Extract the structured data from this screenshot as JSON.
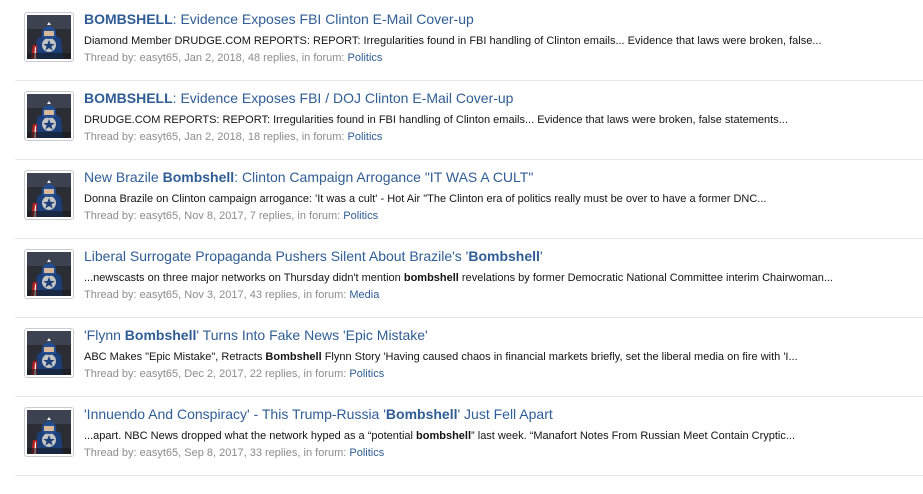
{
  "colors": {
    "link": "#2f5d95",
    "text": "#141414",
    "muted": "#8c8c8c",
    "divider": "#e3e6ea"
  },
  "avatar_icon": "captain-america-avatar",
  "results": [
    {
      "title_parts": [
        {
          "text": "BOMBSHELL",
          "bold": true
        },
        {
          "text": ": Evidence Exposes FBI Clinton E-Mail Cover-up",
          "bold": false
        }
      ],
      "snippet_parts": [
        {
          "text": "Diamond Member DRUDGE.COM REPORTS: REPORT: Irregularities found in FBI handling of Clinton emails... Evidence that laws were broken, false...",
          "bold": false
        }
      ],
      "meta_prefix": "Thread by: ",
      "author": "easyt65",
      "meta_middle": ", Jan 2, 2018, 48 replies, in forum: ",
      "forum": "Politics"
    },
    {
      "title_parts": [
        {
          "text": "BOMBSHELL",
          "bold": true
        },
        {
          "text": ": Evidence Exposes FBI / DOJ Clinton E-Mail Cover-up",
          "bold": false
        }
      ],
      "snippet_parts": [
        {
          "text": "DRUDGE.COM REPORTS: REPORT: Irregularities found in FBI handling of Clinton emails... Evidence that laws were broken, false statements...",
          "bold": false
        }
      ],
      "meta_prefix": "Thread by: ",
      "author": "easyt65",
      "meta_middle": ", Jan 2, 2018, 18 replies, in forum: ",
      "forum": "Politics"
    },
    {
      "title_parts": [
        {
          "text": "New Brazile ",
          "bold": false
        },
        {
          "text": "Bombshell",
          "bold": true
        },
        {
          "text": ": Clinton Campaign Arrogance \"IT WAS A CULT\"",
          "bold": false
        }
      ],
      "snippet_parts": [
        {
          "text": "Donna Brazile on Clinton campaign arrogance: 'It was a cult' - Hot Air \"The Clinton era of politics really must be over to have a former DNC...",
          "bold": false
        }
      ],
      "meta_prefix": "Thread by: ",
      "author": "easyt65",
      "meta_middle": ", Nov 8, 2017, 7 replies, in forum: ",
      "forum": "Politics"
    },
    {
      "title_parts": [
        {
          "text": "Liberal Surrogate Propaganda Pushers Silent About Brazile's '",
          "bold": false
        },
        {
          "text": "Bombshell",
          "bold": true
        },
        {
          "text": "'",
          "bold": false
        }
      ],
      "snippet_parts": [
        {
          "text": "...newscasts on three major networks on Thursday didn't mention ",
          "bold": false
        },
        {
          "text": "bombshell",
          "bold": true
        },
        {
          "text": " revelations by former Democratic National Committee interim Chairwoman...",
          "bold": false
        }
      ],
      "meta_prefix": "Thread by: ",
      "author": "easyt65",
      "meta_middle": ", Nov 3, 2017, 43 replies, in forum: ",
      "forum": "Media"
    },
    {
      "title_parts": [
        {
          "text": "'Flynn ",
          "bold": false
        },
        {
          "text": "Bombshell",
          "bold": true
        },
        {
          "text": "' Turns Into Fake News 'Epic Mistake'",
          "bold": false
        }
      ],
      "snippet_parts": [
        {
          "text": "ABC Makes \"Epic Mistake\", Retracts ",
          "bold": false
        },
        {
          "text": "Bombshell",
          "bold": true
        },
        {
          "text": " Flynn Story 'Having caused chaos in financial markets briefly, set the liberal media on fire with 'I...",
          "bold": false
        }
      ],
      "meta_prefix": "Thread by: ",
      "author": "easyt65",
      "meta_middle": ", Dec 2, 2017, 22 replies, in forum: ",
      "forum": "Politics"
    },
    {
      "title_parts": [
        {
          "text": "'Innuendo And Conspiracy' - This Trump-Russia '",
          "bold": false
        },
        {
          "text": "Bombshell",
          "bold": true
        },
        {
          "text": "' Just Fell Apart",
          "bold": false
        }
      ],
      "snippet_parts": [
        {
          "text": "...apart. NBC News dropped what the network hyped as a “potential ",
          "bold": false
        },
        {
          "text": "bombshell",
          "bold": true
        },
        {
          "text": "” last week. “Manafort Notes From Russian Meet Contain Cryptic...",
          "bold": false
        }
      ],
      "meta_prefix": "Thread by: ",
      "author": "easyt65",
      "meta_middle": ", Sep 8, 2017, 33 replies, in forum: ",
      "forum": "Politics"
    }
  ]
}
